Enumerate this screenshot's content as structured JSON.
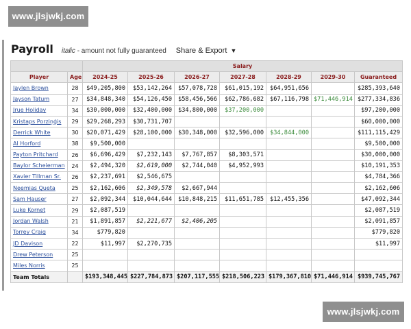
{
  "watermark": {
    "top": "www.jlsjwkj.com",
    "bottom": "www.jlsjwkj.com"
  },
  "header": {
    "title": "Payroll",
    "note_italic": "italic",
    "note_rest": "- amount not fully guaranteed",
    "share_label": "Share & Export",
    "share_caret": "▼"
  },
  "table": {
    "group_header": "Salary",
    "columns": [
      "Player",
      "Age",
      "2024-25",
      "2025-26",
      "2026-27",
      "2027-28",
      "2028-29",
      "2029-30",
      "Guaranteed"
    ],
    "rows": [
      {
        "player": "Jaylen Brown",
        "age": "28",
        "y1": "$49,205,800",
        "y2": "$53,142,264",
        "y3": "$57,078,728",
        "y4": "$61,015,192",
        "y5": "$64,951,656",
        "y6": "",
        "gtd": "$285,393,640"
      },
      {
        "player": "Jayson Tatum",
        "age": "27",
        "y1": "$34,848,340",
        "y2": "$54,126,450",
        "y3": "$58,456,566",
        "y4": "$62,786,682",
        "y5": "$67,116,798",
        "y6": "$71,446,914",
        "gtd": "$277,334,836"
      },
      {
        "player": "Jrue Holiday",
        "age": "34",
        "y1": "$30,000,000",
        "y2": "$32,400,000",
        "y3": "$34,800,000",
        "y4": "$37,200,000",
        "y5": "",
        "y6": "",
        "gtd": "$97,200,000"
      },
      {
        "player": "Kristaps Porziņģis",
        "age": "29",
        "y1": "$29,268,293",
        "y2": "$30,731,707",
        "y3": "",
        "y4": "",
        "y5": "",
        "y6": "",
        "gtd": "$60,000,000"
      },
      {
        "player": "Derrick White",
        "age": "30",
        "y1": "$20,071,429",
        "y2": "$28,100,000",
        "y3": "$30,348,000",
        "y4": "$32,596,000",
        "y5": "$34,844,000",
        "y6": "",
        "gtd": "$111,115,429"
      },
      {
        "player": "Al Horford",
        "age": "38",
        "y1": "$9,500,000",
        "y2": "",
        "y3": "",
        "y4": "",
        "y5": "",
        "y6": "",
        "gtd": "$9,500,000"
      },
      {
        "player": "Payton Pritchard",
        "age": "26",
        "y1": "$6,696,429",
        "y2": "$7,232,143",
        "y3": "$7,767,857",
        "y4": "$8,303,571",
        "y5": "",
        "y6": "",
        "gtd": "$30,000,000"
      },
      {
        "player": "Baylor Scheierman",
        "age": "24",
        "y1": "$2,494,320",
        "y2": "$2,619,000",
        "y3": "$2,744,040",
        "y4": "$4,952,993",
        "y5": "",
        "y6": "",
        "gtd": "$10,191,353"
      },
      {
        "player": "Xavier Tillman Sr.",
        "age": "26",
        "y1": "$2,237,691",
        "y2": "$2,546,675",
        "y3": "",
        "y4": "",
        "y5": "",
        "y6": "",
        "gtd": "$4,784,366"
      },
      {
        "player": "Neemias Queta",
        "age": "25",
        "y1": "$2,162,606",
        "y2": "$2,349,578",
        "y3": "$2,667,944",
        "y4": "",
        "y5": "",
        "y6": "",
        "gtd": "$2,162,606"
      },
      {
        "player": "Sam Hauser",
        "age": "27",
        "y1": "$2,092,344",
        "y2": "$10,044,644",
        "y3": "$10,848,215",
        "y4": "$11,651,785",
        "y5": "$12,455,356",
        "y6": "",
        "gtd": "$47,092,344"
      },
      {
        "player": "Luke Kornet",
        "age": "29",
        "y1": "$2,087,519",
        "y2": "",
        "y3": "",
        "y4": "",
        "y5": "",
        "y6": "",
        "gtd": "$2,087,519"
      },
      {
        "player": "Jordan Walsh",
        "age": "21",
        "y1": "$1,891,857",
        "y2": "$2,221,677",
        "y3": "$2,406,205",
        "y4": "",
        "y5": "",
        "y6": "",
        "gtd": "$2,091,857"
      },
      {
        "player": "Torrey Craig",
        "age": "34",
        "y1": "$779,820",
        "y2": "",
        "y3": "",
        "y4": "",
        "y5": "",
        "y6": "",
        "gtd": "$779,820"
      },
      {
        "player": "JD Davison",
        "age": "22",
        "y1": "$11,997",
        "y2": "$2,270,735",
        "y3": "",
        "y4": "",
        "y5": "",
        "y6": "",
        "gtd": "$11,997"
      },
      {
        "player": "Drew Peterson",
        "age": "25",
        "y1": "",
        "y2": "",
        "y3": "",
        "y4": "",
        "y5": "",
        "y6": "",
        "gtd": ""
      },
      {
        "player": "Miles Norris",
        "age": "25",
        "y1": "",
        "y2": "",
        "y3": "",
        "y4": "",
        "y5": "",
        "y6": "",
        "gtd": ""
      }
    ],
    "totals": {
      "label": "Team Totals",
      "y1": "$193,348,445",
      "y2": "$227,784,873",
      "y3": "$207,117,555",
      "y4": "$218,506,223",
      "y5": "$179,367,810",
      "y6": "$71,446,914",
      "gtd": "$939,745,767"
    }
  },
  "colors": {
    "header_text": "#8a1c1c",
    "link": "#2a4e9c",
    "option_value": "#3a8a3a",
    "watermark_bg": "#8f8f8f"
  }
}
